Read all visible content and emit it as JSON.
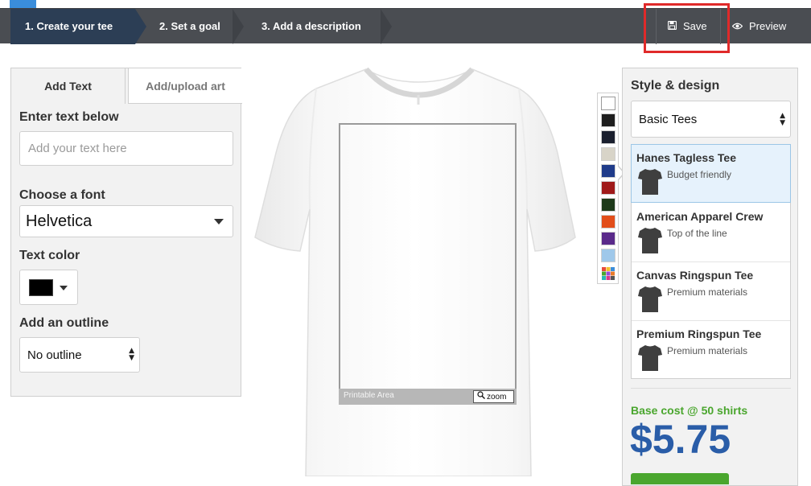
{
  "steps": [
    {
      "label": "1. Create your tee",
      "active": true
    },
    {
      "label": "2. Set a goal",
      "active": false
    },
    {
      "label": "3. Add a description",
      "active": false
    }
  ],
  "toolbar": {
    "save_label": "Save",
    "save_icon": "floppy-disk-icon",
    "preview_label": "Preview",
    "preview_icon": "eye-icon"
  },
  "left_panel": {
    "tabs": [
      {
        "label": "Add Text",
        "active": true
      },
      {
        "label": "Add/upload art",
        "active": false
      }
    ],
    "text_label": "Enter text below",
    "text_value": "",
    "text_placeholder": "Add your text here",
    "font_label": "Choose a font",
    "font_value": "Helvetica",
    "color_label": "Text color",
    "color_value": "#000000",
    "outline_label": "Add an outline",
    "outline_value": "No outline"
  },
  "canvas": {
    "printable_area_label": "Printable Area",
    "zoom_label": "zoom"
  },
  "palette": {
    "colors": [
      "#ffffff",
      "#1e1e1e",
      "#1a1f2e",
      "#d8d4c8",
      "#1f3b8a",
      "#a01a1a",
      "#1e3a1a",
      "#e24e1a",
      "#5a2a8a",
      "#9fc8ea"
    ],
    "selected_color": "#ffffff",
    "more_icon": "multicolor-grid-icon"
  },
  "right_panel": {
    "title": "Style & design",
    "style_value": "Basic Tees",
    "products": [
      {
        "name": "Hanes Tagless Tee",
        "desc": "Budget friendly",
        "selected": true
      },
      {
        "name": "American Apparel Crew",
        "desc": "Top of the line",
        "selected": false
      },
      {
        "name": "Canvas Ringspun Tee",
        "desc": "Premium materials",
        "selected": false
      },
      {
        "name": "Premium Ringspun Tee",
        "desc": "Premium materials",
        "selected": false
      }
    ],
    "base_cost_label": "Base cost @ 50 shirts",
    "price": "$5.75"
  }
}
